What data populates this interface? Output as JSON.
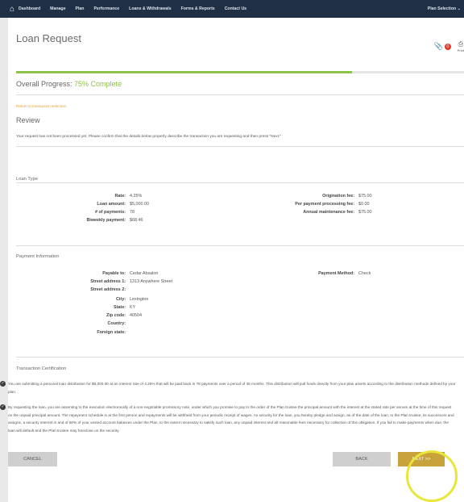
{
  "nav": {
    "items": [
      "Dashboard",
      "Manage",
      "Plan",
      "Performance",
      "Loans & Withdrawals",
      "Forms & Reports",
      "Contact Us"
    ],
    "plan_selection": "Plan Selection"
  },
  "page": {
    "title": "Loan Request",
    "badge_count": "0",
    "print_label": "Print"
  },
  "progress": {
    "label": "Overall Progress: ",
    "value": "75% Complete",
    "fraction": 0.75
  },
  "review": {
    "return_link": "Return to transaction selection",
    "heading": "Review",
    "message": "Your request has not been processed yet. Please confirm that the details below properly describe the transaction you are requesting and then press \"Next.\""
  },
  "loan_type": {
    "heading": "Loan Type",
    "left": [
      {
        "label": "Rate:",
        "value": "4.25%"
      },
      {
        "label": "Loan amount:",
        "value": "$5,000.00"
      },
      {
        "label": "# of payments:",
        "value": "78"
      },
      {
        "label": "Biweekly payment:",
        "value": "$68.46"
      }
    ],
    "right": [
      {
        "label": "Origination fee:",
        "value": "$75.00"
      },
      {
        "label": "Per payment processing fee:",
        "value": "$0.00"
      },
      {
        "label": "Annual maintenance fee:",
        "value": "$75.00"
      }
    ]
  },
  "payment_info": {
    "heading": "Payment Information",
    "fields": [
      {
        "label": "Payable to:",
        "value": "Cedar Absalon"
      },
      {
        "label": "Street address 1:",
        "value": "1313 Anywhere Street"
      },
      {
        "label": "Street address 2:",
        "value": ""
      },
      {
        "label": "City:",
        "value": "Lexington"
      },
      {
        "label": "State:",
        "value": "KY"
      },
      {
        "label": "Zip code:",
        "value": "40504"
      },
      {
        "label": "Country:",
        "value": ""
      },
      {
        "label": "Foreign state:",
        "value": ""
      }
    ],
    "method_label": "Payment Method:",
    "method_value": "Check"
  },
  "certification": {
    "heading": "Transaction Certification",
    "item1": "You are submitting a personal loan distribution for $5,000.00 at an interest rate of 4.25% that will be paid back in 78 payments over a period of 36 months. This distribution will pull funds directly from your plan assets according to the distribution methods defined by your plan.",
    "item2": "By requesting the loan, you are assenting to the execution electronically of a non-negotiable promissory note, under which you promise to pay to the order of the Plan trustee the principal amount with the interest at the stated rate per annum at the time of this request on the unpaid principal amount. The repayment schedule is at the first person and repayments will be withheld from your periodic receipt of wages. As security for the loan, you hereby pledge and assign, as of the date of the loan, to the Plan trustee, its successors and assigns, a security interest in and of 50% of your vested account balances under the Plan, to the extent necessary to satisfy such loan, any unpaid interest and all reasonable fees necessary for collection of this obligation. If you fail to make payments when due, the loan will default and the Plan trustee may foreclose on the security."
  },
  "buttons": {
    "cancel": "CANCEL",
    "back": "BACK",
    "next": "NEXT >>"
  },
  "colors": {
    "nav_bg": "#1f2f45",
    "progress_green": "#8cc34a",
    "next_button": "#c8a23a",
    "highlight_ring": "#e9e63a"
  }
}
